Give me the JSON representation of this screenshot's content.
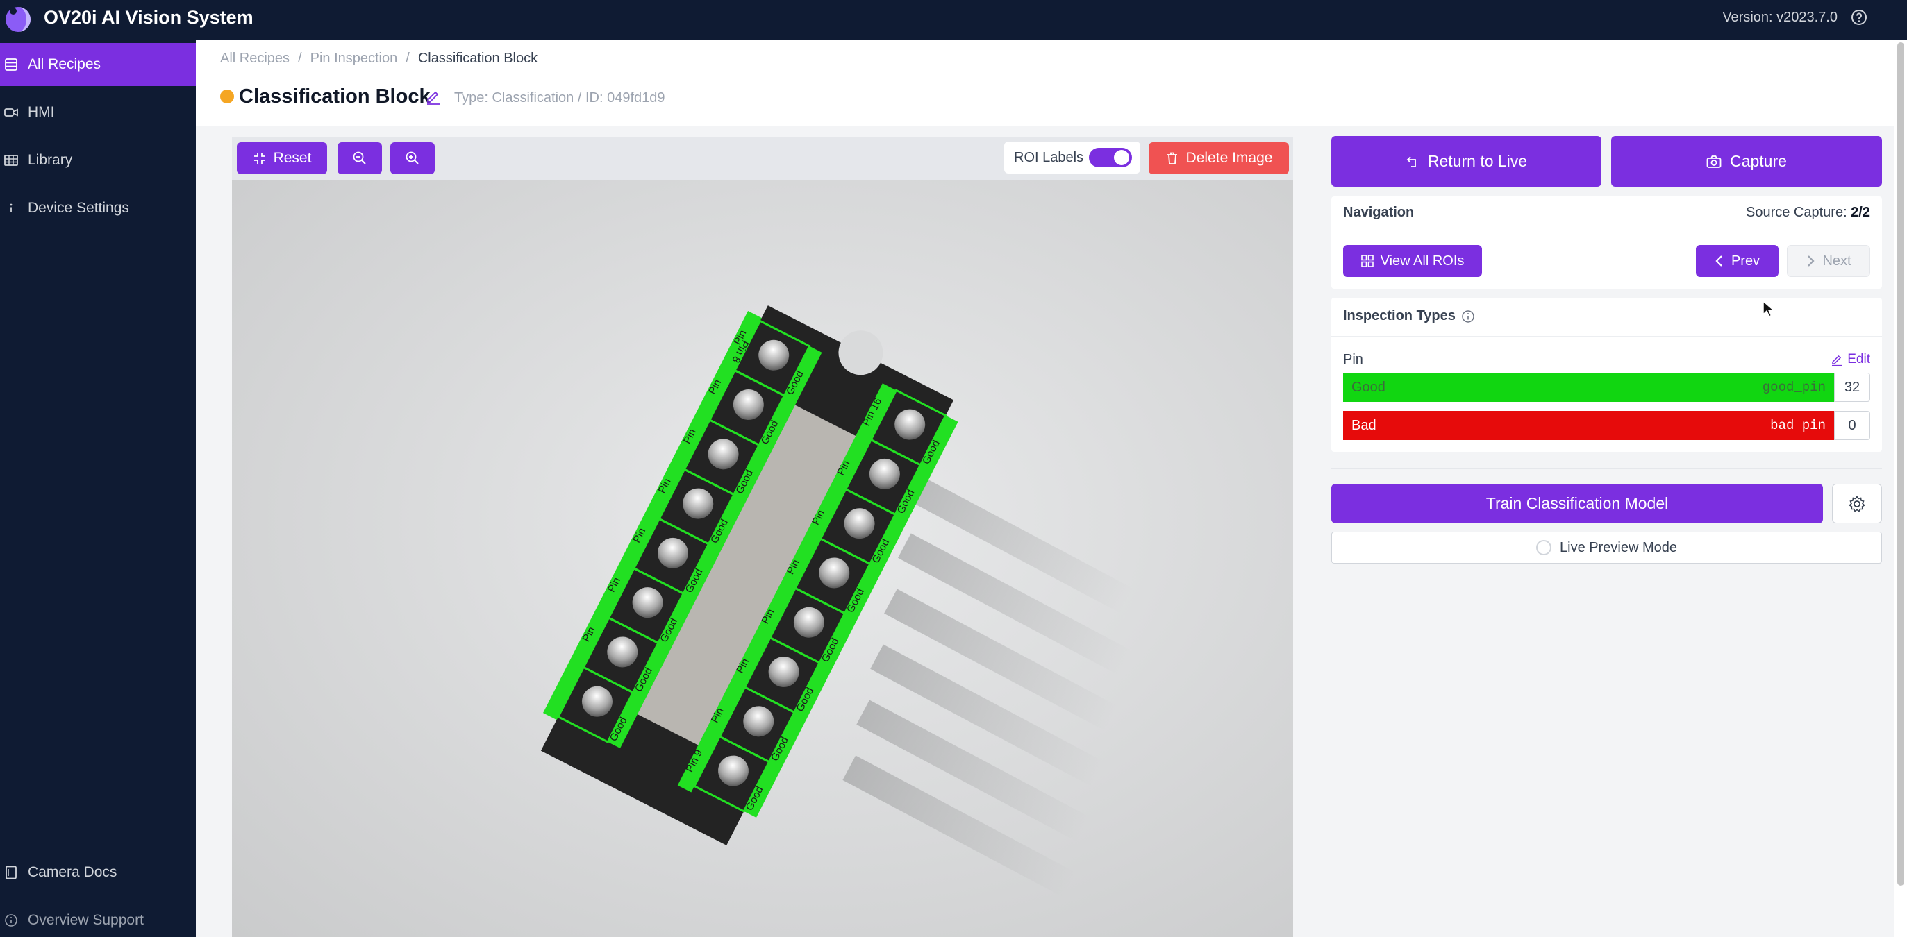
{
  "app": {
    "title": "OV20i AI Vision System",
    "version": "Version: v2023.7.0"
  },
  "sidebar": {
    "items": [
      {
        "label": "All Recipes",
        "icon": "list-icon",
        "active": true
      },
      {
        "label": "HMI",
        "icon": "video-icon"
      },
      {
        "label": "Library",
        "icon": "table-icon"
      },
      {
        "label": "Device Settings",
        "icon": "info-icon"
      }
    ],
    "bottom": [
      {
        "label": "Camera Docs",
        "icon": "document-icon"
      },
      {
        "label": "Overview Support",
        "icon": "help-icon"
      }
    ]
  },
  "breadcrumb": {
    "items": [
      "All Recipes",
      "Pin Inspection",
      "Classification Block"
    ],
    "separator": "/"
  },
  "header": {
    "title": "Classification Block",
    "meta": "Type: Classification / ID: 049fd1d9",
    "status_color": "#f5a623"
  },
  "toolbar": {
    "reset": "Reset",
    "roi_labels": "ROI Labels",
    "roi_labels_on": true,
    "delete": "Delete Image"
  },
  "image": {
    "roi_color": "#22e022",
    "left_column": {
      "label": "Pin",
      "end_label": "Pin 8",
      "result": "Good"
    },
    "right_column": {
      "label": "Pin",
      "start_label": "Pin 9",
      "end_label": "Pin 16",
      "result": "Good"
    }
  },
  "actions": {
    "return_live": "Return to Live",
    "capture": "Capture"
  },
  "navigation": {
    "title": "Navigation",
    "source_label": "Source Capture: ",
    "source_value": "2/2",
    "view_all": "View All ROIs",
    "prev": "Prev",
    "next": "Next"
  },
  "inspection": {
    "title": "Inspection Types",
    "type": "Pin",
    "edit": "Edit",
    "classes": [
      {
        "name": "Good",
        "code": "good_pin",
        "count": "32",
        "color": "#11d611"
      },
      {
        "name": "Bad",
        "code": "bad_pin",
        "count": "0",
        "color": "#e60b0b"
      }
    ]
  },
  "train": {
    "label": "Train Classification Model"
  },
  "live_preview": {
    "label": "Live Preview Mode"
  },
  "colors": {
    "accent": "#7b2fe0",
    "nav_bg": "#0f1b33",
    "danger": "#f05252"
  }
}
